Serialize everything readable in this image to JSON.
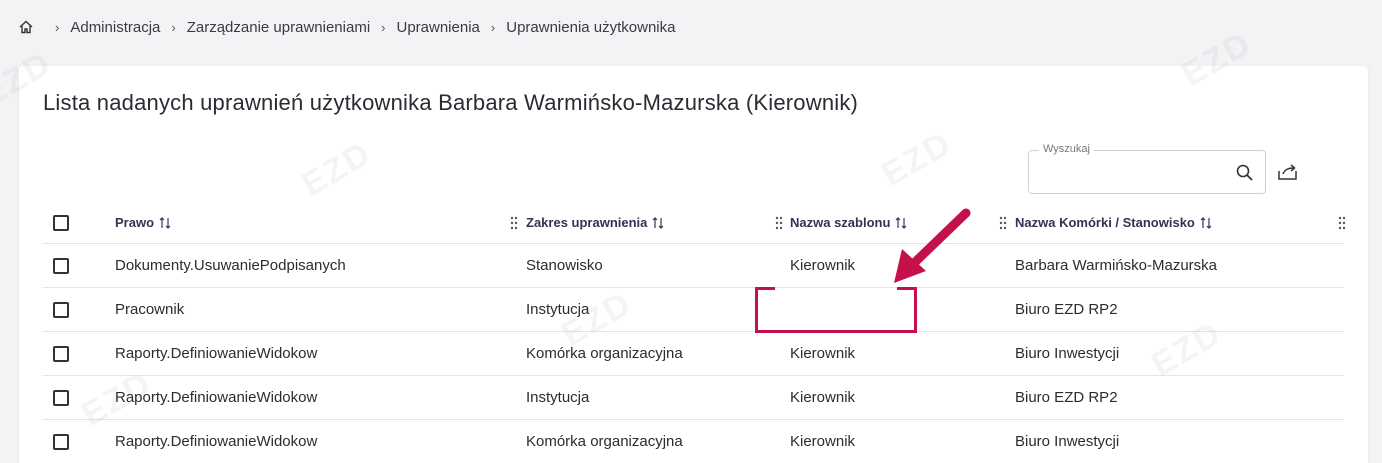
{
  "breadcrumb": {
    "items": [
      "Administracja",
      "Zarządzanie uprawnieniami",
      "Uprawnienia",
      "Uprawnienia użytkownika"
    ]
  },
  "page": {
    "title": "Lista nadanych uprawnień użytkownika Barbara Warmińsko-Mazurska (Kierownik)"
  },
  "search": {
    "label": "Wyszukaj",
    "value": ""
  },
  "table": {
    "columns": [
      "Prawo",
      "Zakres uprawnienia",
      "Nazwa szablonu",
      "Nazwa Komórki / Stanowisko"
    ],
    "rows": [
      {
        "prawo": "Dokumenty.UsuwaniePodpisanych",
        "zakres": "Stanowisko",
        "szablon": "Kierownik",
        "komorka": "Barbara Warmińsko-Mazurska"
      },
      {
        "prawo": "Pracownik",
        "zakres": "Instytucja",
        "szablon": "",
        "komorka": "Biuro EZD RP2"
      },
      {
        "prawo": "Raporty.DefiniowanieWidokow",
        "zakres": "Komórka organizacyjna",
        "szablon": "Kierownik",
        "komorka": "Biuro Inwestycji"
      },
      {
        "prawo": "Raporty.DefiniowanieWidokow",
        "zakres": "Instytucja",
        "szablon": "Kierownik",
        "komorka": "Biuro EZD RP2"
      },
      {
        "prawo": "Raporty.DefiniowanieWidokow",
        "zakres": "Komórka organizacyjna",
        "szablon": "Kierownik",
        "komorka": "Biuro Inwestycji"
      }
    ]
  },
  "colors": {
    "accent": "#c4114a",
    "header_text": "#3b2f56"
  },
  "icons": [
    "home-icon",
    "search-icon",
    "export-icon",
    "sort-icon",
    "drag-handle-icon",
    "arrow-icon"
  ]
}
